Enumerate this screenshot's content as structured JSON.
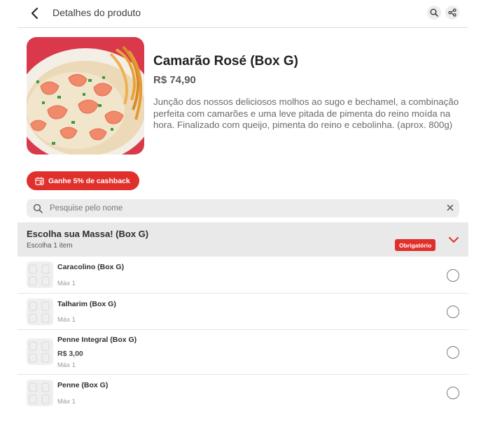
{
  "header": {
    "title": "Detalhes do produto",
    "back_icon": "arrow-left-icon",
    "search_icon": "search-icon",
    "share_icon": "share-icon"
  },
  "product": {
    "name": "Camarão Rosé (Box G)",
    "price": "R$ 74,90",
    "description": "Junção dos nossos deliciosos molhos ao sugo e bechamel, a combinação perfeita com camarões e uma leve pitada de pimenta do reino moída na hora. Finalizado com queijo, pimenta do reino e cebolinha. (aprox. 800g)"
  },
  "cashback": {
    "label": "Ganhe 5% de cashback",
    "icon": "cashback-icon"
  },
  "search": {
    "placeholder": "Pesquise pelo nome",
    "value": ""
  },
  "group": {
    "title": "Escolha sua Massa! (Box G)",
    "subtitle": "Escolha 1 item",
    "badge": "Obrigatório"
  },
  "options": [
    {
      "name": "Caracolino (Box G)",
      "price": "",
      "max": "Máx 1"
    },
    {
      "name": "Talharim (Box G)",
      "price": "",
      "max": "Máx 1"
    },
    {
      "name": "Penne Integral (Box G)",
      "price": "R$ 3,00",
      "max": "Máx 1"
    },
    {
      "name": "Penne (Box G)",
      "price": "",
      "max": "Máx 1"
    }
  ],
  "colors": {
    "accent": "#e0302c",
    "header_divider": "#dcdcdc",
    "group_bg": "#e9e9e9",
    "search_bg": "#ececec"
  }
}
